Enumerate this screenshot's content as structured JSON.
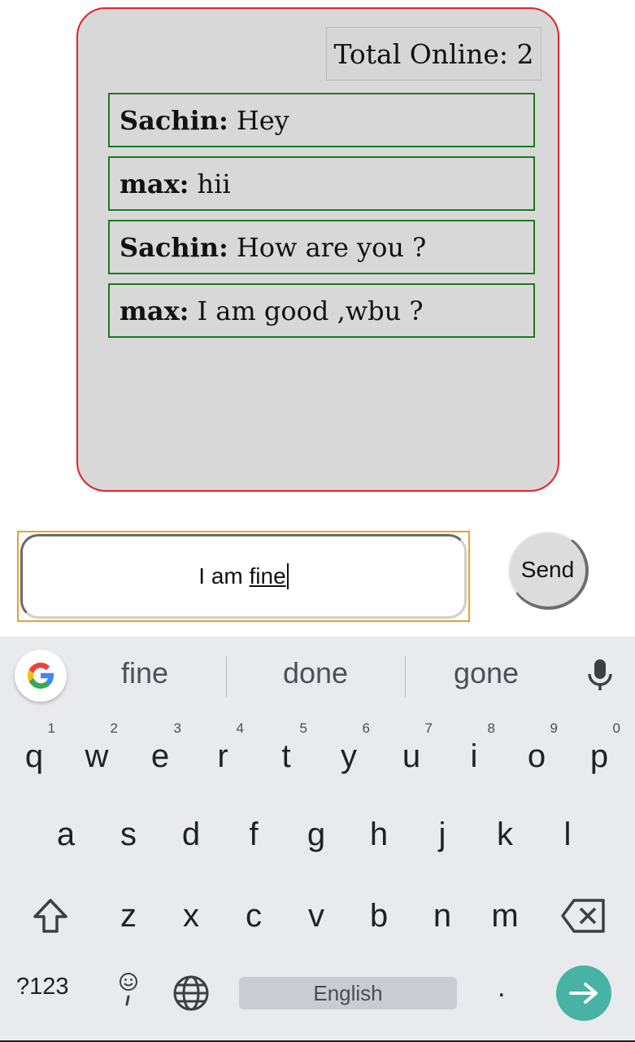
{
  "chat": {
    "online_label": "Total Online: 2",
    "messages": [
      {
        "user": "Sachin:",
        "text": "Hey"
      },
      {
        "user": "max:",
        "text": "hii"
      },
      {
        "user": "Sachin:",
        "text": "How are you ?"
      },
      {
        "user": "max:",
        "text": "I am good ,wbu ?"
      }
    ]
  },
  "composer": {
    "text_before": "I am ",
    "text_current_word": "fine",
    "send_label": "Send"
  },
  "keyboard": {
    "suggestions": [
      "fine",
      "done",
      "gone"
    ],
    "row1": [
      {
        "k": "q",
        "h": "1"
      },
      {
        "k": "w",
        "h": "2"
      },
      {
        "k": "e",
        "h": "3"
      },
      {
        "k": "r",
        "h": "4"
      },
      {
        "k": "t",
        "h": "5"
      },
      {
        "k": "y",
        "h": "6"
      },
      {
        "k": "u",
        "h": "7"
      },
      {
        "k": "i",
        "h": "8"
      },
      {
        "k": "o",
        "h": "9"
      },
      {
        "k": "p",
        "h": "0"
      }
    ],
    "row2": [
      "a",
      "s",
      "d",
      "f",
      "g",
      "h",
      "j",
      "k",
      "l"
    ],
    "row3": [
      "z",
      "x",
      "c",
      "v",
      "b",
      "n",
      "m"
    ],
    "symbols_label": "?123",
    "space_label": "English",
    "period_label": ".",
    "icons": {
      "google": "google-icon",
      "mic": "mic-icon",
      "shift": "shift-icon",
      "backspace": "backspace-icon",
      "emoji": "emoji-icon",
      "globe": "globe-icon",
      "enter": "enter-arrow-icon"
    },
    "accent_color": "#46b3a4"
  }
}
